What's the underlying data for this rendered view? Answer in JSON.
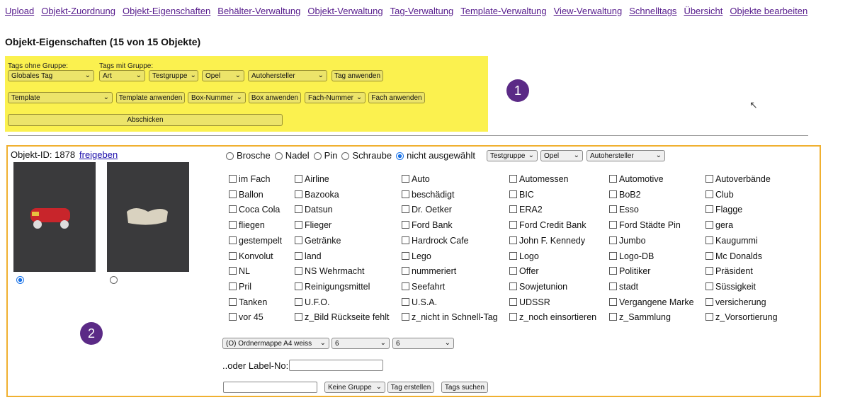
{
  "nav": [
    "Upload",
    "Objekt-Zuordnung",
    "Objekt-Eigenschaften",
    "Behälter-Verwaltung",
    "Objekt-Verwaltung",
    "Tag-Verwaltung",
    "Template-Verwaltung",
    "View-Verwaltung",
    "Schnelltags",
    "Übersicht",
    "Objekte bearbeiten"
  ],
  "title": "Objekt-Eigenschaften (15 von 15 Objekte)",
  "panel": {
    "tags_ohne_gruppe": "Tags ohne Gruppe:",
    "tags_mit_gruppe": "Tags mit Gruppe:",
    "global_tag": "Globales Tag",
    "art": "Art",
    "gruppe": "Testgruppe",
    "tag": "Opel",
    "tag2": "Autohersteller",
    "tag_apply": "Tag anwenden",
    "template": "Template",
    "template_apply": "Template anwenden",
    "box": "Box-Nummer",
    "box_apply": "Box anwenden",
    "fach": "Fach-Nummer",
    "fach_apply": "Fach anwenden",
    "submit": "Abschicken"
  },
  "markers": [
    "1",
    "2"
  ],
  "object": {
    "id_label": "Objekt-ID: 1878",
    "release": "freigeben",
    "types": [
      "Brosche",
      "Nadel",
      "Pin",
      "Schraube",
      "nicht ausgewählt"
    ],
    "selected_type": "nicht ausgewählt",
    "gruppe": "Testgruppe",
    "tag": "Opel",
    "tag2": "Autohersteller",
    "tags": [
      [
        "im Fach",
        "Airline",
        "Auto",
        "Automessen",
        "Automotive",
        "Autoverbände"
      ],
      [
        "Ballon",
        "Bazooka",
        "beschädigt",
        "BIC",
        "BoB2",
        "Club"
      ],
      [
        "Coca Cola",
        "Datsun",
        "Dr. Oetker",
        "ERA2",
        "Esso",
        "Flagge"
      ],
      [
        "fliegen",
        "Flieger",
        "Ford Bank",
        "Ford Credit Bank",
        "Ford Städte Pin",
        "gera"
      ],
      [
        "gestempelt",
        "Getränke",
        "Hardrock Cafe",
        "John F. Kennedy",
        "Jumbo",
        "Kaugummi"
      ],
      [
        "Konvolut",
        "land",
        "Lego",
        "Logo",
        "Logo-DB",
        "Mc Donalds"
      ],
      [
        "NL",
        "NS Wehrmacht",
        "nummeriert",
        "Offer",
        "Politiker",
        "Präsident"
      ],
      [
        "Pril",
        "Reinigungsmittel",
        "Seefahrt",
        "Sowjetunion",
        "stadt",
        "Süssigkeit"
      ],
      [
        "Tanken",
        "U.F.O.",
        "U.S.A.",
        "UDSSR",
        "Vergangene Marke",
        "versicherung"
      ],
      [
        "vor 45",
        "z_Bild Rückseite fehlt",
        "z_nicht in Schnell-Tag",
        "z_noch einsortieren",
        "z_Sammlung",
        "z_Vorsortierung"
      ]
    ],
    "container": "(O) Ordnermappe A4 weiss",
    "box": "6",
    "fach": "6",
    "label_no": "..oder Label-No:",
    "group_select": "Keine Gruppe",
    "create_tag": "Tag erstellen",
    "search_tags": "Tags suchen"
  }
}
